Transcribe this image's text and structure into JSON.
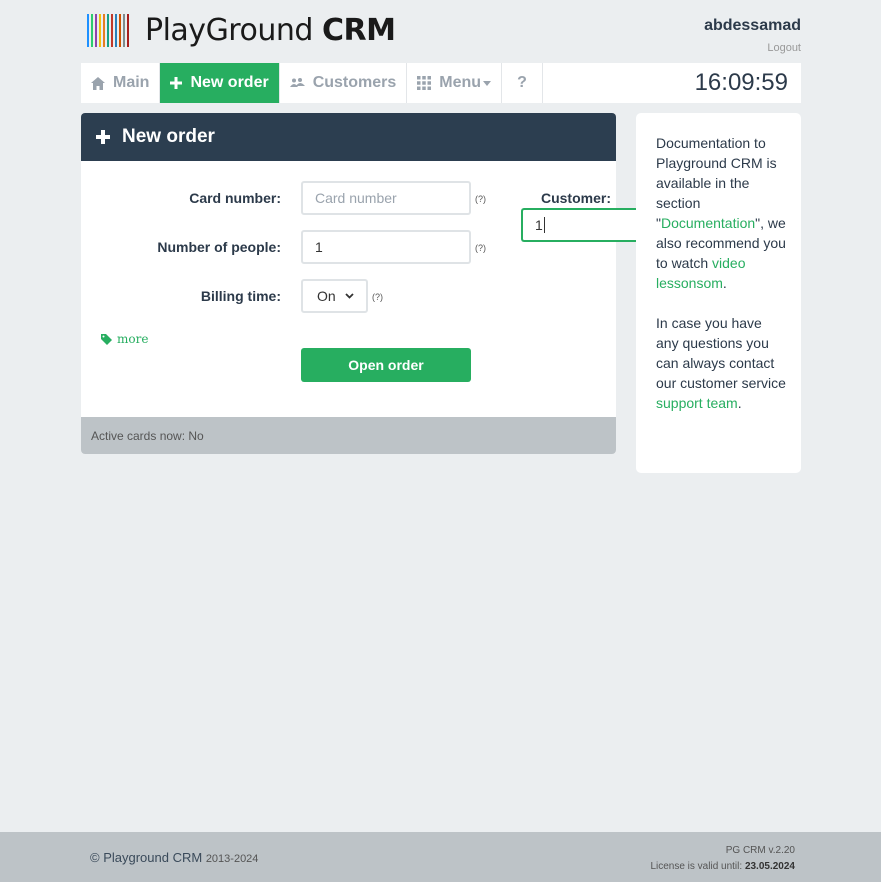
{
  "header": {
    "logo_text_light": "PlayGround",
    "logo_text_bold": "CRM",
    "logo_bar_colors": [
      "#1e90ff",
      "#2ecc71",
      "#8e44ad",
      "#f1c40f",
      "#e67e22",
      "#16a085",
      "#c0392b",
      "#2980b9",
      "#d35400",
      "#7f8c8d",
      "#a61e1e"
    ],
    "username": "abdessamad",
    "logout_label": "Logout"
  },
  "nav": {
    "main_label": "Main",
    "new_order_label": "New order",
    "customers_label": "Customers",
    "menu_label": "Menu",
    "help_label": "?",
    "clock": "16:09:59"
  },
  "panel": {
    "title": "New order",
    "card_number_label": "Card number:",
    "card_number_placeholder": "Card number",
    "people_label": "Number of people:",
    "people_value": "1",
    "billing_label": "Billing time:",
    "billing_value": "On",
    "hint": "(?)",
    "customer_label": "Customer:",
    "customer_value": "1",
    "more_label": "more",
    "open_button": "Open order",
    "active_cards": "Active cards now: No"
  },
  "side": {
    "p1_pre": "Documentation to Playground CRM is available in the section \"",
    "doc_link": "Documentation",
    "p1_mid": "\", we also recommend you to watch ",
    "video_link": "video lessonsom",
    "p1_end": ".",
    "p2_pre": "In case you have any questions you can always contact our customer service ",
    "support_link": "support team",
    "p2_end": "."
  },
  "footer": {
    "copyright": "© Playground CRM",
    "years": "2013-2024",
    "version": "PG CRM v.2.20",
    "license_label": "License is valid until:",
    "license_date": "23.05.2024"
  },
  "colors": {
    "accent": "#27ae60",
    "dark": "#2c3e50",
    "background": "#ebeef0"
  }
}
